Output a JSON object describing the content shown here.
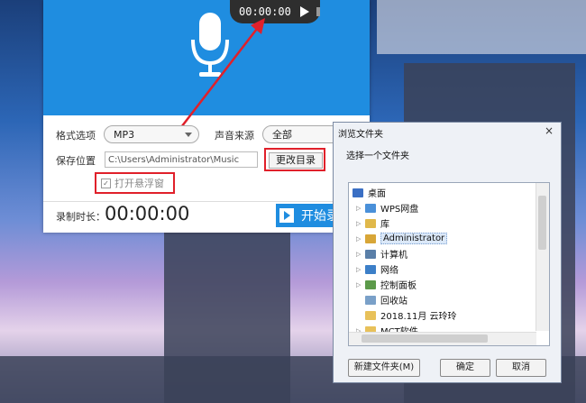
{
  "recorder": {
    "timer": "00:00:00",
    "format_label": "格式选项",
    "format_value": "MP3",
    "source_label": "声音来源",
    "source_value": "全部",
    "save_label": "保存位置",
    "save_path": "C:\\Users\\Administrator\\Music",
    "change_dir": "更改目录",
    "float_window": "打开悬浮窗",
    "duration_label": "录制时长：",
    "duration": "00:00:00",
    "start": "开始录"
  },
  "dialog": {
    "title": "浏览文件夹",
    "close": "×",
    "prompt": "选择一个文件夹",
    "tree": [
      {
        "label": "桌面",
        "icon": "desktop-icon",
        "color": "#3a6fc4"
      },
      {
        "label": "WPS网盘",
        "icon": "cloud-icon",
        "color": "#4a90d9"
      },
      {
        "label": "库",
        "icon": "library-icon",
        "color": "#e0b84a"
      },
      {
        "label": "Administrator",
        "icon": "user-folder-icon",
        "color": "#d8a637"
      },
      {
        "label": "计算机",
        "icon": "computer-icon",
        "color": "#5a7fa8"
      },
      {
        "label": "网络",
        "icon": "network-icon",
        "color": "#3c7fc8"
      },
      {
        "label": "控制面板",
        "icon": "control-panel-icon",
        "color": "#5c9a4a"
      },
      {
        "label": "回收站",
        "icon": "recycle-bin-icon",
        "color": "#7aa0c8"
      },
      {
        "label": "2018.11月 云玲玲",
        "icon": "folder-icon",
        "color": "#e8c15a"
      },
      {
        "label": "MCT软件",
        "icon": "folder-icon",
        "color": "#e8c15a"
      }
    ],
    "buttons": {
      "new_folder": "新建文件夹(M)",
      "ok": "确定",
      "cancel": "取消"
    }
  }
}
